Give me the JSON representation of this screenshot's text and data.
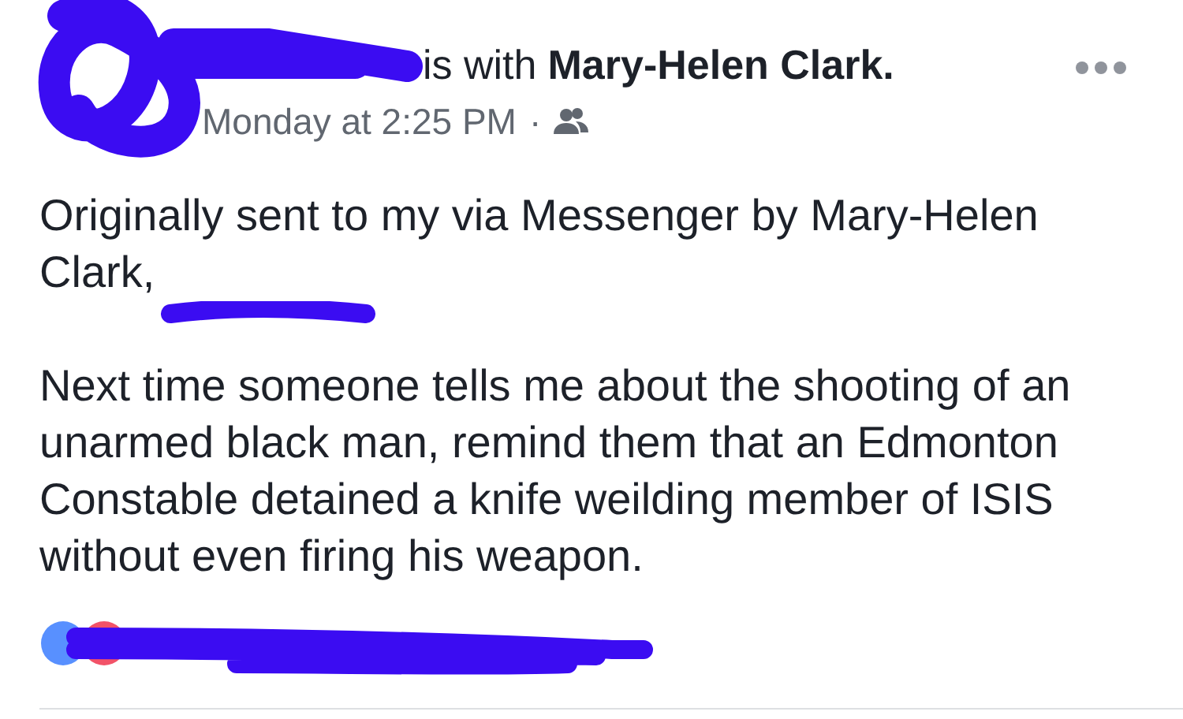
{
  "post": {
    "header": {
      "with_text": "is with",
      "tagged_name": "Mary-Helen Clark.",
      "time": "Monday at 2:25 PM",
      "separator": "·"
    },
    "paragraphs": [
      "Originally sent to my via Messenger by Mary-Helen Clark,",
      "Next time someone tells me about the shooting of an unarmed black man, remind them that an Edmonton Constable detained a knife weilding member of ISIS without even firing his weapon."
    ]
  }
}
